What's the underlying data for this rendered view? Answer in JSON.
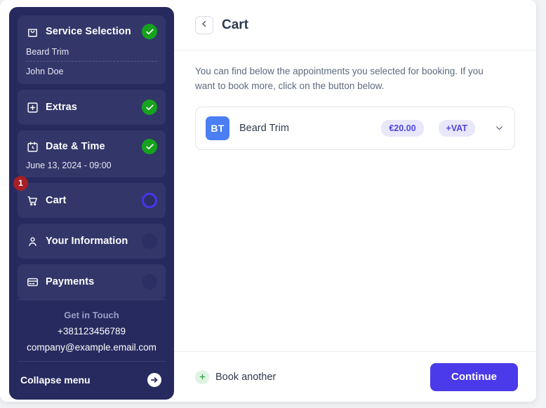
{
  "sidebar": {
    "steps": [
      {
        "id": "service-selection",
        "label": "Service Selection",
        "icon": "shopping-bag-icon",
        "status": "done",
        "details": [
          "Beard Trim",
          "John Doe"
        ]
      },
      {
        "id": "extras",
        "label": "Extras",
        "icon": "plus-square-icon",
        "status": "done",
        "details": []
      },
      {
        "id": "date-time",
        "label": "Date & Time",
        "icon": "calendar-clock-icon",
        "status": "done",
        "details": [
          "June 13, 2024 - 09:00"
        ]
      },
      {
        "id": "cart",
        "label": "Cart",
        "icon": "shopping-cart-icon",
        "status": "active",
        "badge": "1",
        "details": []
      },
      {
        "id": "your-information",
        "label": "Your Information",
        "icon": "user-icon",
        "status": "idle",
        "details": []
      },
      {
        "id": "payments",
        "label": "Payments",
        "icon": "credit-card-icon",
        "status": "idle",
        "details": []
      }
    ],
    "contact": {
      "title": "Get in Touch",
      "phone": "+381123456789",
      "email": "company@example.email.com"
    },
    "collapse": {
      "label": "Collapse menu",
      "icon": "arrow-right-circle-icon"
    }
  },
  "main": {
    "back_icon": "chevron-left-icon",
    "title": "Cart",
    "intro": "You can find below the appointments you selected for booking. If you want to book more, click on the button below.",
    "cart_items": [
      {
        "initials": "BT",
        "name": "Beard Trim",
        "price": "€20.00",
        "vat": "+VAT",
        "expand_icon": "chevron-down-icon"
      }
    ],
    "footer": {
      "book_another_label": "Book another",
      "book_another_icon": "plus-icon",
      "continue_label": "Continue"
    }
  },
  "colors": {
    "sidebar_bg": "#262a5e",
    "sidebar_item_bg": "#333669",
    "accent_primary": "#4a3aea",
    "status_done": "#16a21f",
    "badge_red": "#a81f26",
    "pill_bg": "#e9e7fb",
    "pill_text": "#4f46e5",
    "avatar_bg": "#4a7ef2"
  }
}
